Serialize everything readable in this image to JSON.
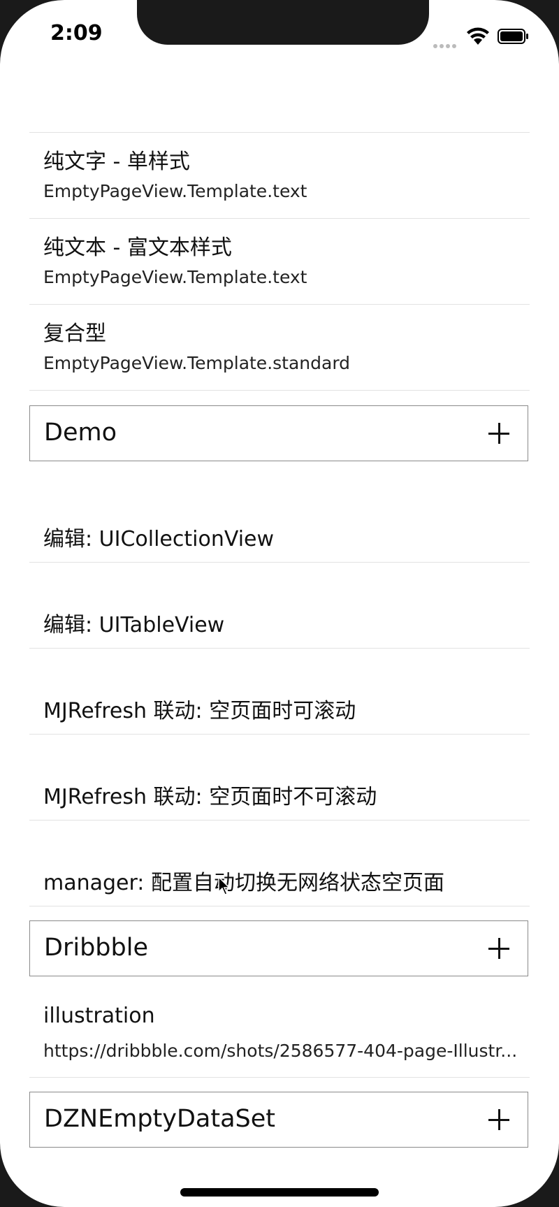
{
  "status_bar": {
    "time": "2:09"
  },
  "template_cells": [
    {
      "title": "纯文字 - 单样式",
      "subtitle": "EmptyPageView.Template.text"
    },
    {
      "title": "纯文本 - 富文本样式",
      "subtitle": "EmptyPageView.Template.text"
    },
    {
      "title": "复合型",
      "subtitle": "EmptyPageView.Template.standard"
    }
  ],
  "sections": {
    "demo": {
      "title": "Demo"
    },
    "dribbble": {
      "title": "Dribbble"
    },
    "dzn": {
      "title": "DZNEmptyDataSet"
    }
  },
  "demo_cells": [
    {
      "title": "编辑: UICollectionView"
    },
    {
      "title": "编辑: UITableView"
    },
    {
      "title": "MJRefresh 联动: 空页面时可滚动"
    },
    {
      "title": "MJRefresh 联动: 空页面时不可滚动"
    },
    {
      "title": "manager: 配置自动切换无网络状态空页面"
    }
  ],
  "dribbble_cells": [
    {
      "title": "illustration",
      "subtitle": "https://dribbble.com/shots/2586577-404-page-Illustr..."
    }
  ],
  "icons": {
    "signal": "signal-icon",
    "wifi": "wifi-icon",
    "battery": "battery-icon",
    "plus": "plus-icon",
    "cursor": "cursor-icon"
  }
}
